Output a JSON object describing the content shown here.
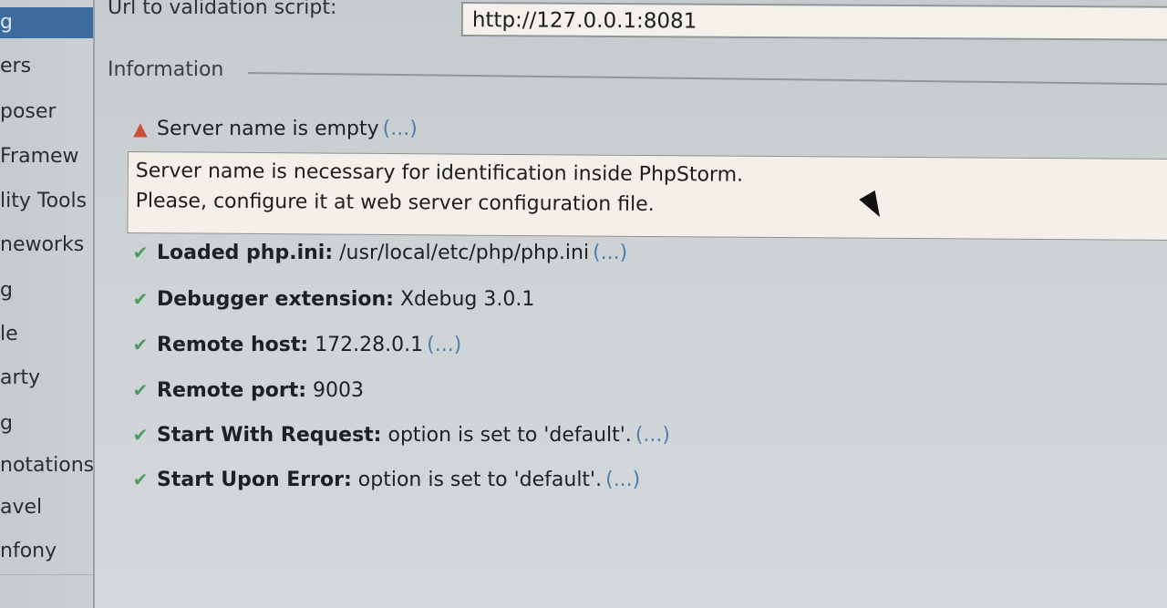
{
  "sidebar": {
    "items": [
      {
        "label": "g",
        "selected": true
      },
      {
        "label": "ers"
      },
      {
        "label": "poser"
      },
      {
        "label": "Framew"
      },
      {
        "label": "lity Tools"
      },
      {
        "label": "neworks"
      },
      {
        "label": "g"
      },
      {
        "label": "le"
      },
      {
        "label": "arty"
      },
      {
        "label": "g"
      },
      {
        "label": "notations"
      },
      {
        "label": "avel"
      },
      {
        "label": "nfony"
      }
    ]
  },
  "form": {
    "url_label": "Url to validation script:",
    "url_value": "http://127.0.0.1:8081"
  },
  "information": {
    "title": "Information",
    "warning": {
      "text": "Server name is empty",
      "more": "(...)"
    },
    "tooltip": {
      "line1": "Server name is necessary for identification inside PhpStorm.",
      "line2": "Please, configure it at web server configuration file."
    },
    "checks": [
      {
        "name": "Loaded php.ini:",
        "value": "/usr/local/etc/php/php.ini",
        "more": "(...)"
      },
      {
        "name": "Debugger extension:",
        "value": "Xdebug 3.0.1",
        "more": ""
      },
      {
        "name": "Remote host:",
        "value": "172.28.0.1",
        "more": "(...)"
      },
      {
        "name": "Remote port:",
        "value": "9003",
        "more": ""
      },
      {
        "name": "Start With Request:",
        "value": "option is set to 'default'.",
        "more": "(...)"
      },
      {
        "name": "Start Upon Error:",
        "value": "option is set to 'default'.",
        "more": "(...)"
      }
    ]
  },
  "icons": {
    "check": "check-icon",
    "warning": "warning-icon"
  },
  "colors": {
    "selection": "#3c6c9d",
    "link": "#4c7fb0",
    "check": "#4e9a60",
    "warning": "#c8503c"
  }
}
